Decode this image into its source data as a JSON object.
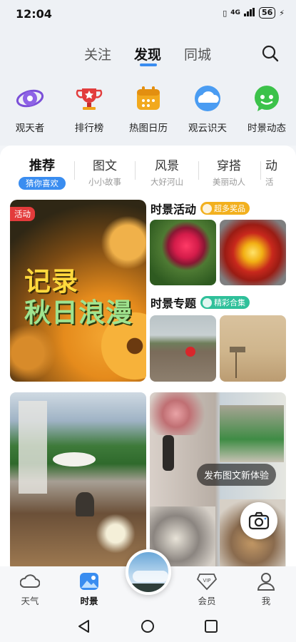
{
  "status_bar": {
    "time": "12:04",
    "network": "4G",
    "battery": "56"
  },
  "header": {
    "tabs": [
      {
        "label": "关注"
      },
      {
        "label": "发现"
      },
      {
        "label": "同城"
      }
    ],
    "active_tab": "发现",
    "search_icon": "search-icon"
  },
  "quick_links": [
    {
      "label": "观天者",
      "icon": "eye-planet-icon",
      "color": "#7b4fd8"
    },
    {
      "label": "排行榜",
      "icon": "trophy-icon",
      "color": "#e23d3d"
    },
    {
      "label": "热图日历",
      "icon": "calendar-icon",
      "color": "#f0a319"
    },
    {
      "label": "观云识天",
      "icon": "cloud-icon",
      "color": "#3a8df0"
    },
    {
      "label": "时景动态",
      "icon": "chat-bubble-icon",
      "color": "#3cc24a"
    }
  ],
  "content_tabs": [
    {
      "title": "推荐",
      "subtitle": "猜你喜欢"
    },
    {
      "title": "图文",
      "subtitle": "小小故事"
    },
    {
      "title": "风景",
      "subtitle": "大好河山"
    },
    {
      "title": "穿搭",
      "subtitle": "美丽动人"
    },
    {
      "title": "动",
      "subtitle": "活"
    }
  ],
  "activity_banner": {
    "badge": "活动",
    "line1": "记录",
    "line2": "秋日浪漫"
  },
  "sections": {
    "activity": {
      "title": "时景活动",
      "tag": "超多奖品",
      "tag_color": "#f2b01e"
    },
    "special": {
      "title": "时景专题",
      "tag": "精彩合集",
      "tag_color": "#2fc09a"
    }
  },
  "feed": {
    "publish_hint": "发布图文新体验"
  },
  "bottom_nav": [
    {
      "label": "天气",
      "icon": "cloud-icon"
    },
    {
      "label": "时景",
      "icon": "photo-icon"
    },
    {
      "label": "会员",
      "icon": "vip-icon"
    },
    {
      "label": "我",
      "icon": "person-icon"
    }
  ],
  "colors": {
    "accent": "#3a8df0"
  }
}
